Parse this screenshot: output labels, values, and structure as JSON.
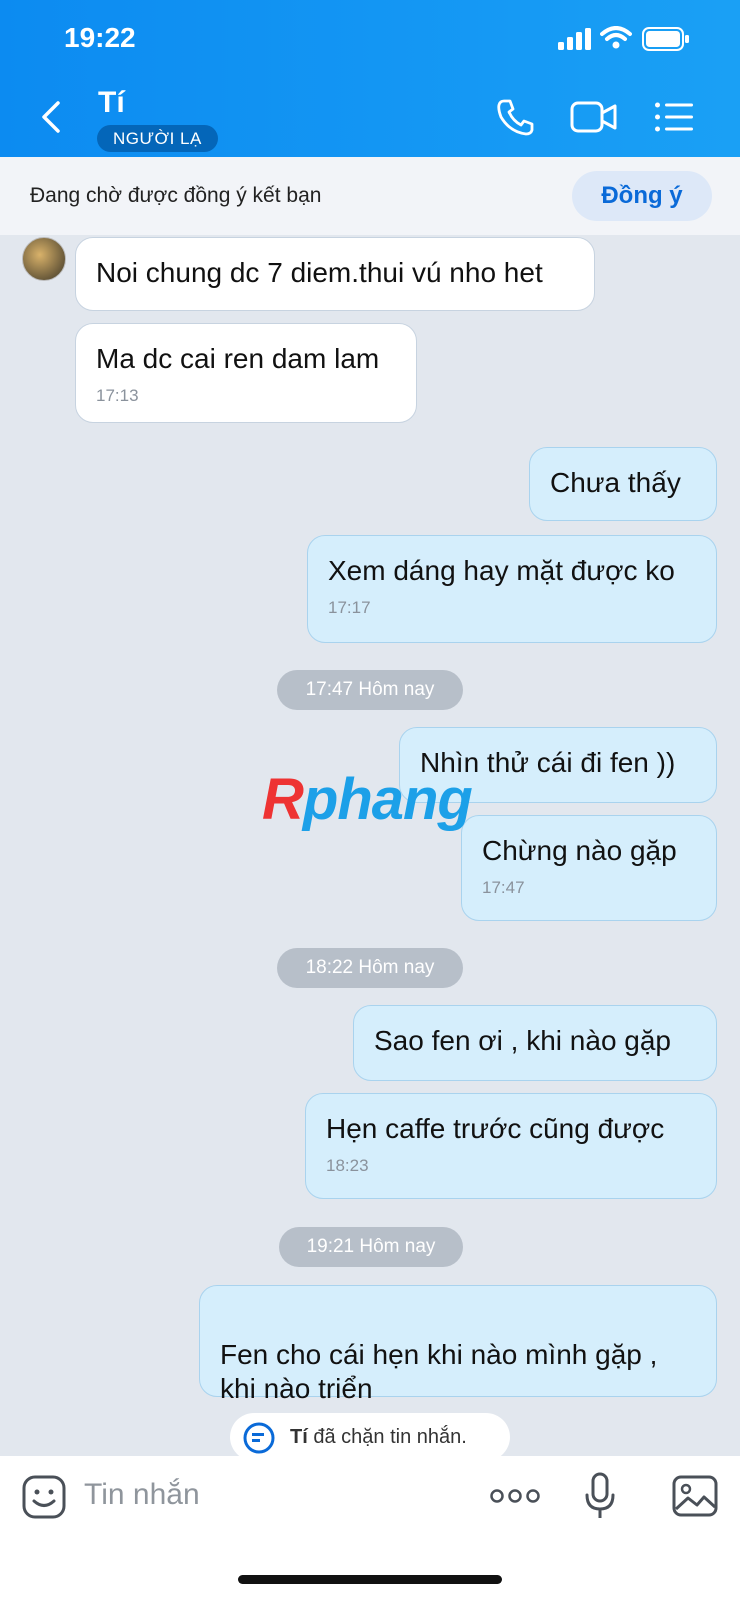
{
  "status": {
    "time": "19:22"
  },
  "header": {
    "title": "Tí",
    "badge": "NGƯỜI LẠ"
  },
  "pending": {
    "text": "Đang chờ được đồng ý kết bạn",
    "button": "Đồng ý"
  },
  "messages": [
    {
      "text": "Noi chung dc 7 diem.thui vú nho het"
    },
    {
      "text": "Ma dc cai ren dam lam",
      "time": "17:13"
    },
    {
      "text": "Chưa thấy"
    },
    {
      "text": "Xem dáng hay mặt được ko",
      "time": "17:17"
    },
    {
      "text": "Nhìn thử cái đi fen ))"
    },
    {
      "text": "Chừng nào gặp",
      "time": "17:47"
    },
    {
      "text": "Sao fen ơi , khi nào gặp"
    },
    {
      "text": "Hẹn caffe trước cũng được",
      "time": "18:23"
    },
    {
      "text": "Fen cho cái hẹn khi nào mình gặp ,\nkhi nào triển"
    }
  ],
  "separators": [
    "17:47 Hôm nay",
    "18:22 Hôm nay",
    "19:21 Hôm nay"
  ],
  "blocked": {
    "name": "Tí",
    "text": " đã chặn tin nhắn."
  },
  "input": {
    "placeholder": "Tin nhắn"
  },
  "watermark": {
    "part1": "R",
    "part2": "phang"
  },
  "icons": {
    "back": "chevron-left-icon",
    "call": "phone-icon",
    "video": "video-icon",
    "menu": "list-menu-icon",
    "sticker": "sticker-smile-icon",
    "more": "more-dots-icon",
    "mic": "microphone-icon",
    "image": "image-icon"
  },
  "colors": {
    "header": "#0c8bf1",
    "accent": "#0a6ad8",
    "out_bubble": "#d5eefc",
    "in_bubble": "#ffffff"
  }
}
